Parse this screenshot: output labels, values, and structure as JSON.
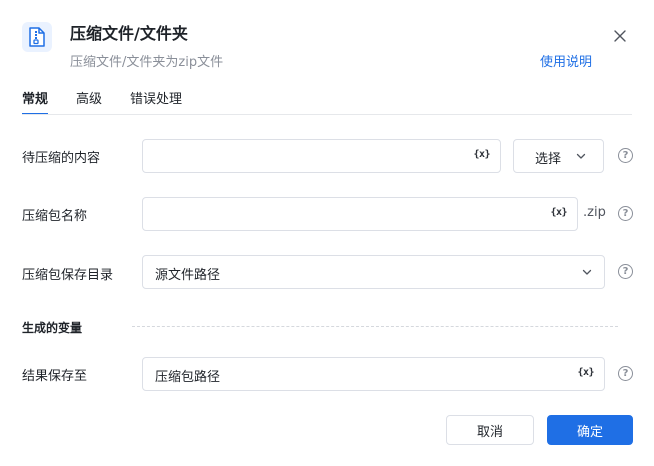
{
  "header": {
    "icon": "zip-file-icon",
    "title": "压缩文件/文件夹",
    "subtitle": "压缩文件/文件夹为zip文件",
    "help_link": "使用说明"
  },
  "tabs": [
    {
      "label": "常规",
      "active": true
    },
    {
      "label": "高级",
      "active": false
    },
    {
      "label": "错误处理",
      "active": false
    }
  ],
  "fields": {
    "content": {
      "label": "待压缩的内容",
      "value": "",
      "var_icon": "{x}",
      "select_label": "选择"
    },
    "zip_name": {
      "label": "压缩包名称",
      "value": "",
      "var_icon": "{x}",
      "suffix": ".zip"
    },
    "save_dir": {
      "label": "压缩包保存目录",
      "value": "源文件路径"
    }
  },
  "section": {
    "title": "生成的变量"
  },
  "output": {
    "label": "结果保存至",
    "value": "压缩包路径",
    "var_icon": "{x}"
  },
  "footer": {
    "cancel_label": "取消",
    "ok_label": "确定"
  },
  "colors": {
    "accent": "#1f6fe5",
    "border": "#dcdfe6",
    "muted": "#8a8f99"
  }
}
